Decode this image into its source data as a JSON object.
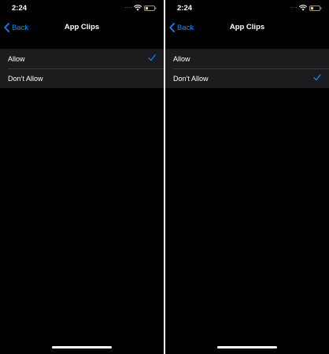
{
  "screens": [
    {
      "status_bar": {
        "time": "2:24",
        "signal": "....",
        "wifi_icon": "wifi-icon",
        "battery_icon": "battery-low-icon"
      },
      "nav_bar": {
        "back_label": "Back",
        "title": "App Clips"
      },
      "options": [
        {
          "label": "Allow",
          "selected": true
        },
        {
          "label": "Don’t Allow",
          "selected": false
        }
      ]
    },
    {
      "status_bar": {
        "time": "2:24",
        "signal": "....",
        "wifi_icon": "wifi-icon",
        "battery_icon": "battery-low-icon"
      },
      "nav_bar": {
        "back_label": "Back",
        "title": "App Clips"
      },
      "options": [
        {
          "label": "Allow",
          "selected": false
        },
        {
          "label": "Don’t Allow",
          "selected": true
        }
      ]
    }
  ],
  "colors": {
    "accent": "#0a84ff",
    "background": "#000000",
    "cell_background": "#1c1c1e",
    "separator": "#38383a",
    "battery_low": "#ffd60a"
  }
}
